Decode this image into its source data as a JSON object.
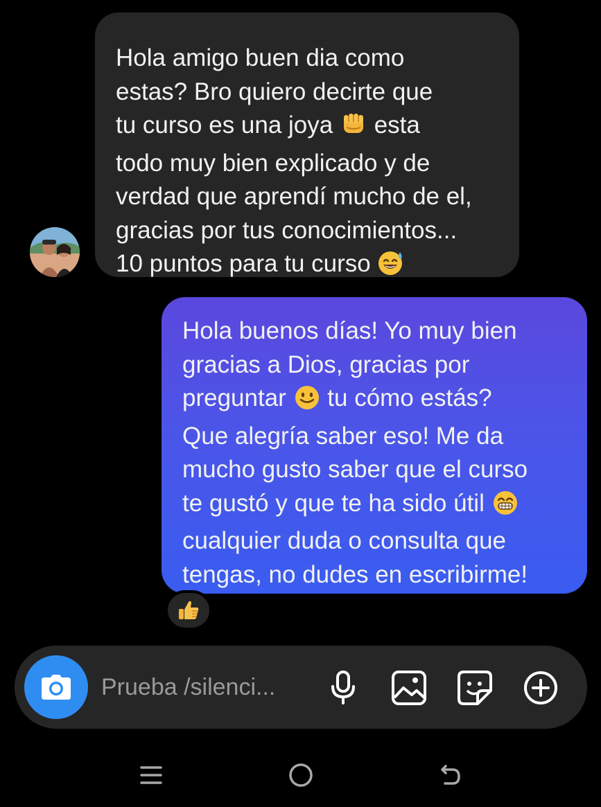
{
  "conversation": {
    "incoming": {
      "text": "Hola amigo buen dia como\nestas? Bro quiero decirte que\ntu curso es una joya ",
      "text_2": " esta\ntodo muy bien explicado y de\nverdad que aprendí mucho de el,\ngracias por tus conocimientos...\n10 puntos para tu curso ",
      "emoji_1": "oncoming-fist",
      "emoji_2": "smiling-face-with-sweat"
    },
    "outgoing": {
      "text": "Hola buenos días! Yo muy bien\ngracias a Dios, gracias por\npreguntar ",
      "text_2": " tu cómo estás?\nQue alegría saber eso! Me da\nmucho gusto saber que el curso\nte gustó y que te ha sido útil ",
      "text_3": "\ncualquier duda o consulta que\ntengas, no dudes en escribirme!",
      "emoji_1": "slightly-smiling-face",
      "emoji_2": "grinning-face-with-smiling-eyes",
      "bubble_gradient": [
        "#5b48de",
        "#3a5cf0"
      ]
    },
    "reaction": "thumbs-up"
  },
  "composer": {
    "placeholder": "Prueba /silenci...",
    "camera_color": "#2f8df2",
    "tools": [
      "microphone-icon",
      "gallery-icon",
      "sticker-icon",
      "add-icon"
    ]
  },
  "navigation": {
    "buttons": [
      "menu-icon",
      "home-icon",
      "back-icon"
    ]
  }
}
